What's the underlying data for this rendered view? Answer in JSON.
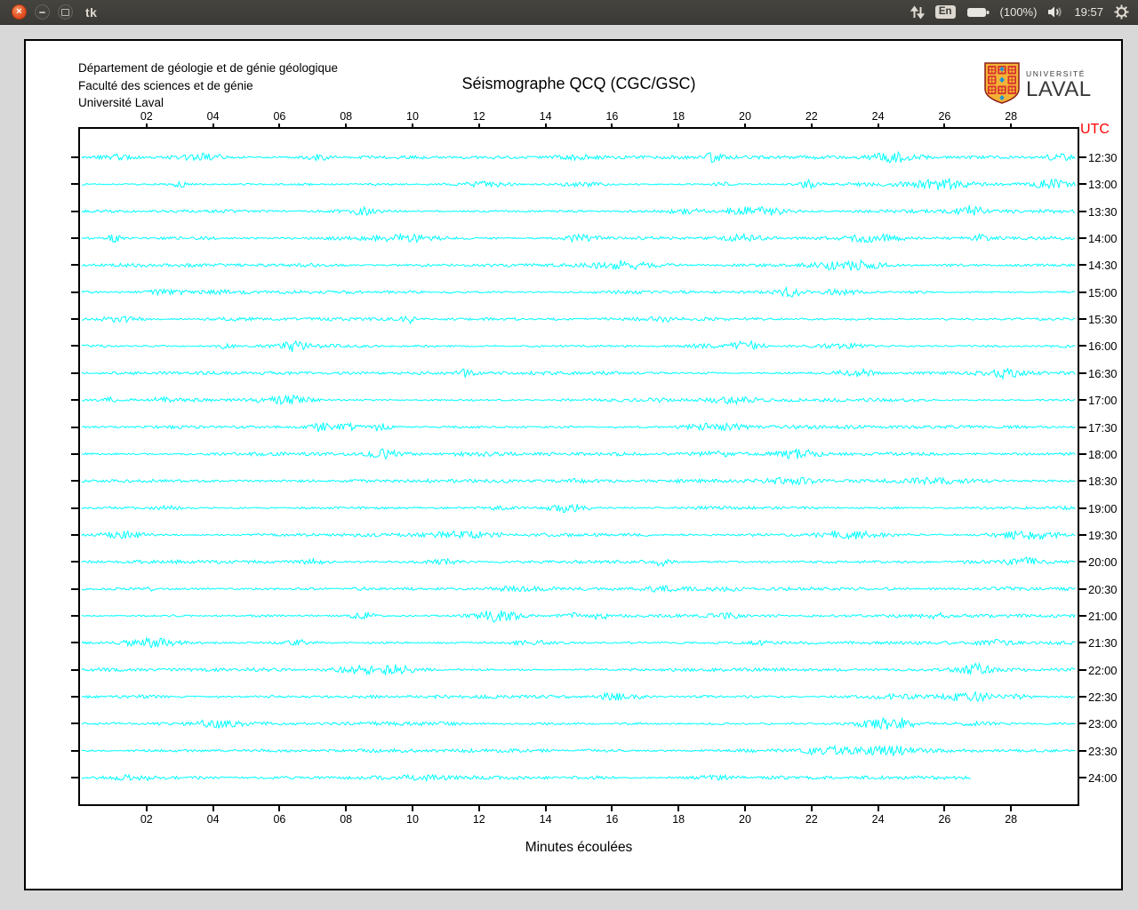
{
  "titlebar": {
    "title": "tk"
  },
  "systray": {
    "keyboard_layout": "En",
    "battery_level": "(100%)",
    "clock": "19:57"
  },
  "app": {
    "header_lines": [
      "Département de géologie et de génie géologique",
      "Faculté des sciences et de génie",
      "Université Laval"
    ],
    "title": "Séismographe QCQ (CGC/GSC)",
    "logo": {
      "top": "UNIVERSITÉ",
      "bottom": "LAVAL",
      "shield_gold": "#f5b335",
      "shield_red": "#d6332f",
      "shield_blue": "#2196d4"
    }
  },
  "chart_data": {
    "type": "line",
    "title": "Séismographe QCQ (CGC/GSC)",
    "xlabel": "Minutes écoulées",
    "x_axis_label_top_right": "UTC",
    "x_ticks": [
      "02",
      "04",
      "06",
      "08",
      "10",
      "12",
      "14",
      "16",
      "18",
      "20",
      "22",
      "24",
      "26",
      "28"
    ],
    "x_range_minutes": [
      0,
      30
    ],
    "rows": 24,
    "row_labels": [
      "12:30",
      "13:00",
      "13:30",
      "14:00",
      "14:30",
      "15:00",
      "15:30",
      "16:00",
      "16:30",
      "17:00",
      "17:30",
      "18:00",
      "18:30",
      "19:00",
      "19:30",
      "20:00",
      "20:30",
      "21:00",
      "21:30",
      "22:00",
      "22:30",
      "23:00",
      "23:30",
      "24:00"
    ],
    "last_row_end_minute": 26.8,
    "trace_color": "#00ffff",
    "utc_color": "#ff0000",
    "grid": false,
    "description": "24 half-hour seismogram traces (helicorder style); each line is ambient noise with occasional short higher-amplitude bursts; final 24:00 trace stops near minute 26.8"
  }
}
